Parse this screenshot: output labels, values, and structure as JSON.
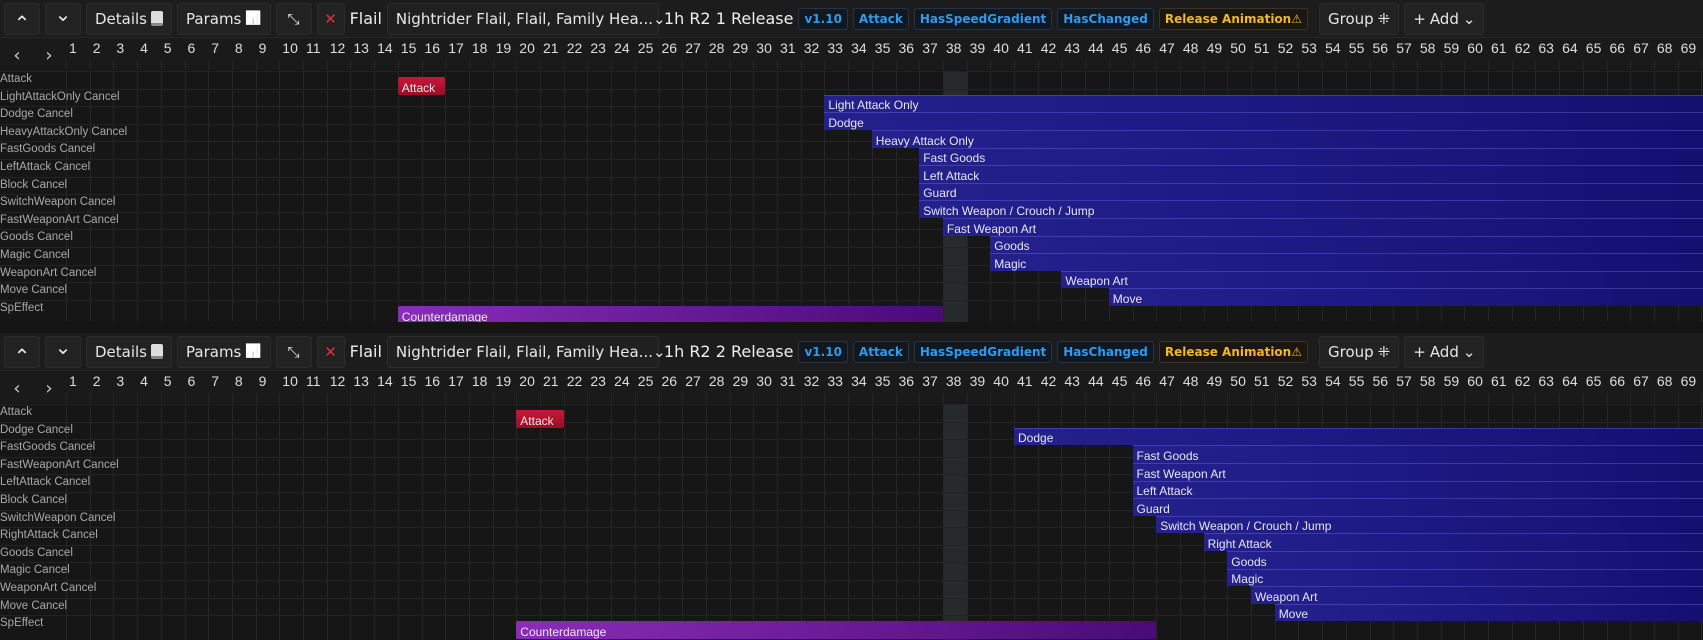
{
  "frames_visible": 70,
  "current_frame": 38,
  "colors": {
    "cancel_bar": "#1e1a85",
    "attack_bar": "#b0112a",
    "speffect_bar": "#7a22a8",
    "badge_blue": "#2d9bf0",
    "badge_warn": "#f2b81e"
  },
  "panels": [
    {
      "toolbar": {
        "details": "Details",
        "params": "Params",
        "weapon_type": "Flail",
        "weapon_select": "Nightrider Flail, Flail, Family Hea...",
        "title": "1h R2 1 Release",
        "badges": [
          "v1.10",
          "Attack",
          "HasSpeedGradient",
          "HasChanged"
        ],
        "warn_badge": "Release Animation",
        "group": "Group",
        "add": "Add"
      },
      "rows": [
        "Attack",
        "LightAttackOnly Cancel",
        "Dodge Cancel",
        "HeavyAttackOnly Cancel",
        "FastGoods Cancel",
        "LeftAttack Cancel",
        "Block Cancel",
        "SwitchWeapon Cancel",
        "FastWeaponArt Cancel",
        "Goods Cancel",
        "Magic Cancel",
        "WeaponArt Cancel",
        "Move Cancel",
        "SpEffect"
      ],
      "bars": [
        {
          "row": 0,
          "label": "Attack",
          "start": 15,
          "end": 16,
          "kind": "attack"
        },
        {
          "row": 1,
          "label": "Light Attack Only",
          "start": 33,
          "end": 70,
          "kind": "cancel"
        },
        {
          "row": 2,
          "label": "Dodge",
          "start": 33,
          "end": 70,
          "kind": "cancel"
        },
        {
          "row": 3,
          "label": "Heavy Attack Only",
          "start": 35,
          "end": 70,
          "kind": "cancel"
        },
        {
          "row": 4,
          "label": "Fast Goods",
          "start": 37,
          "end": 70,
          "kind": "cancel"
        },
        {
          "row": 5,
          "label": "Left Attack",
          "start": 37,
          "end": 70,
          "kind": "cancel"
        },
        {
          "row": 6,
          "label": "Guard",
          "start": 37,
          "end": 70,
          "kind": "cancel"
        },
        {
          "row": 7,
          "label": "Switch Weapon / Crouch / Jump",
          "start": 37,
          "end": 70,
          "kind": "cancel"
        },
        {
          "row": 8,
          "label": "Fast Weapon Art",
          "start": 38,
          "end": 70,
          "kind": "cancel"
        },
        {
          "row": 9,
          "label": "Goods",
          "start": 40,
          "end": 70,
          "kind": "cancel"
        },
        {
          "row": 10,
          "label": "Magic",
          "start": 40,
          "end": 70,
          "kind": "cancel"
        },
        {
          "row": 11,
          "label": "Weapon Art",
          "start": 43,
          "end": 70,
          "kind": "cancel"
        },
        {
          "row": 12,
          "label": "Move",
          "start": 45,
          "end": 70,
          "kind": "cancel"
        },
        {
          "row": 13,
          "label": "Counterdamage",
          "start": 15,
          "end": 37,
          "kind": "speffect"
        }
      ]
    },
    {
      "toolbar": {
        "details": "Details",
        "params": "Params",
        "weapon_type": "Flail",
        "weapon_select": "Nightrider Flail, Flail, Family Hea...",
        "title": "1h R2 2 Release",
        "badges": [
          "v1.10",
          "Attack",
          "HasSpeedGradient",
          "HasChanged"
        ],
        "warn_badge": "Release Animation",
        "group": "Group",
        "add": "Add"
      },
      "rows": [
        "Attack",
        "Dodge Cancel",
        "FastGoods Cancel",
        "FastWeaponArt Cancel",
        "LeftAttack Cancel",
        "Block Cancel",
        "SwitchWeapon Cancel",
        "RightAttack Cancel",
        "Goods Cancel",
        "Magic Cancel",
        "WeaponArt Cancel",
        "Move Cancel",
        "SpEffect"
      ],
      "bars": [
        {
          "row": 0,
          "label": "Attack",
          "start": 20,
          "end": 21,
          "kind": "attack"
        },
        {
          "row": 1,
          "label": "Dodge",
          "start": 41,
          "end": 70,
          "kind": "cancel"
        },
        {
          "row": 2,
          "label": "Fast Goods",
          "start": 46,
          "end": 70,
          "kind": "cancel"
        },
        {
          "row": 3,
          "label": "Fast Weapon Art",
          "start": 46,
          "end": 70,
          "kind": "cancel"
        },
        {
          "row": 4,
          "label": "Left Attack",
          "start": 46,
          "end": 70,
          "kind": "cancel"
        },
        {
          "row": 5,
          "label": "Guard",
          "start": 46,
          "end": 70,
          "kind": "cancel"
        },
        {
          "row": 6,
          "label": "Switch Weapon / Crouch / Jump",
          "start": 47,
          "end": 70,
          "kind": "cancel"
        },
        {
          "row": 7,
          "label": "Right Attack",
          "start": 49,
          "end": 70,
          "kind": "cancel"
        },
        {
          "row": 8,
          "label": "Goods",
          "start": 50,
          "end": 70,
          "kind": "cancel"
        },
        {
          "row": 9,
          "label": "Magic",
          "start": 50,
          "end": 70,
          "kind": "cancel"
        },
        {
          "row": 10,
          "label": "Weapon Art",
          "start": 51,
          "end": 70,
          "kind": "cancel"
        },
        {
          "row": 11,
          "label": "Move",
          "start": 52,
          "end": 70,
          "kind": "cancel"
        },
        {
          "row": 12,
          "label": "Counterdamage",
          "start": 20,
          "end": 46,
          "kind": "speffect"
        }
      ]
    }
  ]
}
